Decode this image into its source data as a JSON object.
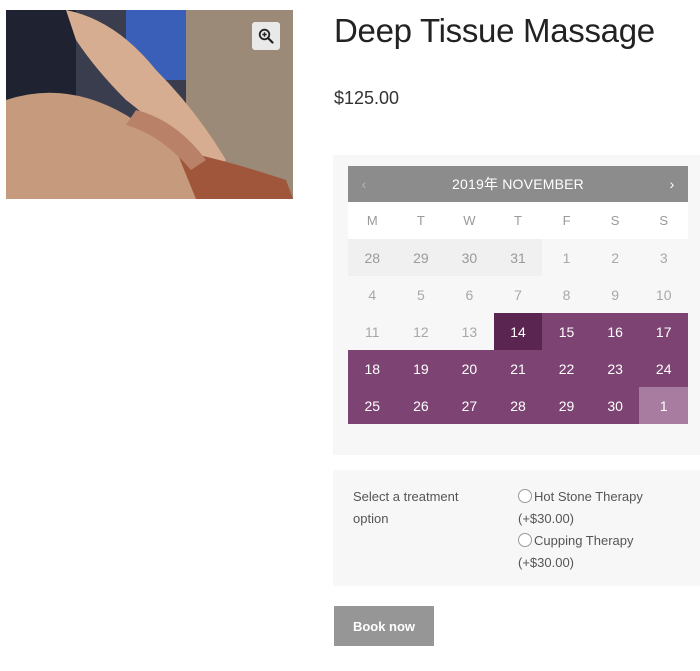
{
  "product": {
    "title": "Deep Tissue Massage",
    "price": "$125.00",
    "image_icon": "massage-hands-photo",
    "zoom_icon": "zoom-in-icon"
  },
  "calendar": {
    "title": "2019年 NOVEMBER",
    "prev_label": "‹",
    "next_label": "›",
    "weekdays": [
      "M",
      "T",
      "W",
      "T",
      "F",
      "S",
      "S"
    ],
    "weeks": [
      [
        {
          "label": "28",
          "state": "prev-month"
        },
        {
          "label": "29",
          "state": "prev-month"
        },
        {
          "label": "30",
          "state": "prev-month"
        },
        {
          "label": "31",
          "state": "prev-month"
        },
        {
          "label": "1",
          "state": "unavailable"
        },
        {
          "label": "2",
          "state": "unavailable"
        },
        {
          "label": "3",
          "state": "unavailable"
        }
      ],
      [
        {
          "label": "4",
          "state": "unavailable"
        },
        {
          "label": "5",
          "state": "unavailable"
        },
        {
          "label": "6",
          "state": "unavailable"
        },
        {
          "label": "7",
          "state": "unavailable"
        },
        {
          "label": "8",
          "state": "unavailable"
        },
        {
          "label": "9",
          "state": "unavailable"
        },
        {
          "label": "10",
          "state": "unavailable"
        }
      ],
      [
        {
          "label": "11",
          "state": "unavailable"
        },
        {
          "label": "12",
          "state": "unavailable"
        },
        {
          "label": "13",
          "state": "unavailable"
        },
        {
          "label": "14",
          "state": "selected"
        },
        {
          "label": "15",
          "state": "available"
        },
        {
          "label": "16",
          "state": "available"
        },
        {
          "label": "17",
          "state": "available"
        }
      ],
      [
        {
          "label": "18",
          "state": "available"
        },
        {
          "label": "19",
          "state": "available"
        },
        {
          "label": "20",
          "state": "available"
        },
        {
          "label": "21",
          "state": "available"
        },
        {
          "label": "22",
          "state": "available"
        },
        {
          "label": "23",
          "state": "available"
        },
        {
          "label": "24",
          "state": "available"
        }
      ],
      [
        {
          "label": "25",
          "state": "available"
        },
        {
          "label": "26",
          "state": "available"
        },
        {
          "label": "27",
          "state": "available"
        },
        {
          "label": "28",
          "state": "available"
        },
        {
          "label": "29",
          "state": "available"
        },
        {
          "label": "30",
          "state": "available"
        },
        {
          "label": "1",
          "state": "next-month"
        }
      ]
    ],
    "colors": {
      "available": "#7d4473",
      "selected": "#5b2552",
      "next_month": "#a87ba1",
      "header": "#8c8c8c"
    }
  },
  "treatment": {
    "label": "Select a treatment option",
    "options": [
      {
        "name": "Hot Stone Therapy",
        "price": "(+$30.00)"
      },
      {
        "name": "Cupping Therapy",
        "price": "(+$30.00)"
      }
    ]
  },
  "book_button": {
    "label": "Book now"
  }
}
